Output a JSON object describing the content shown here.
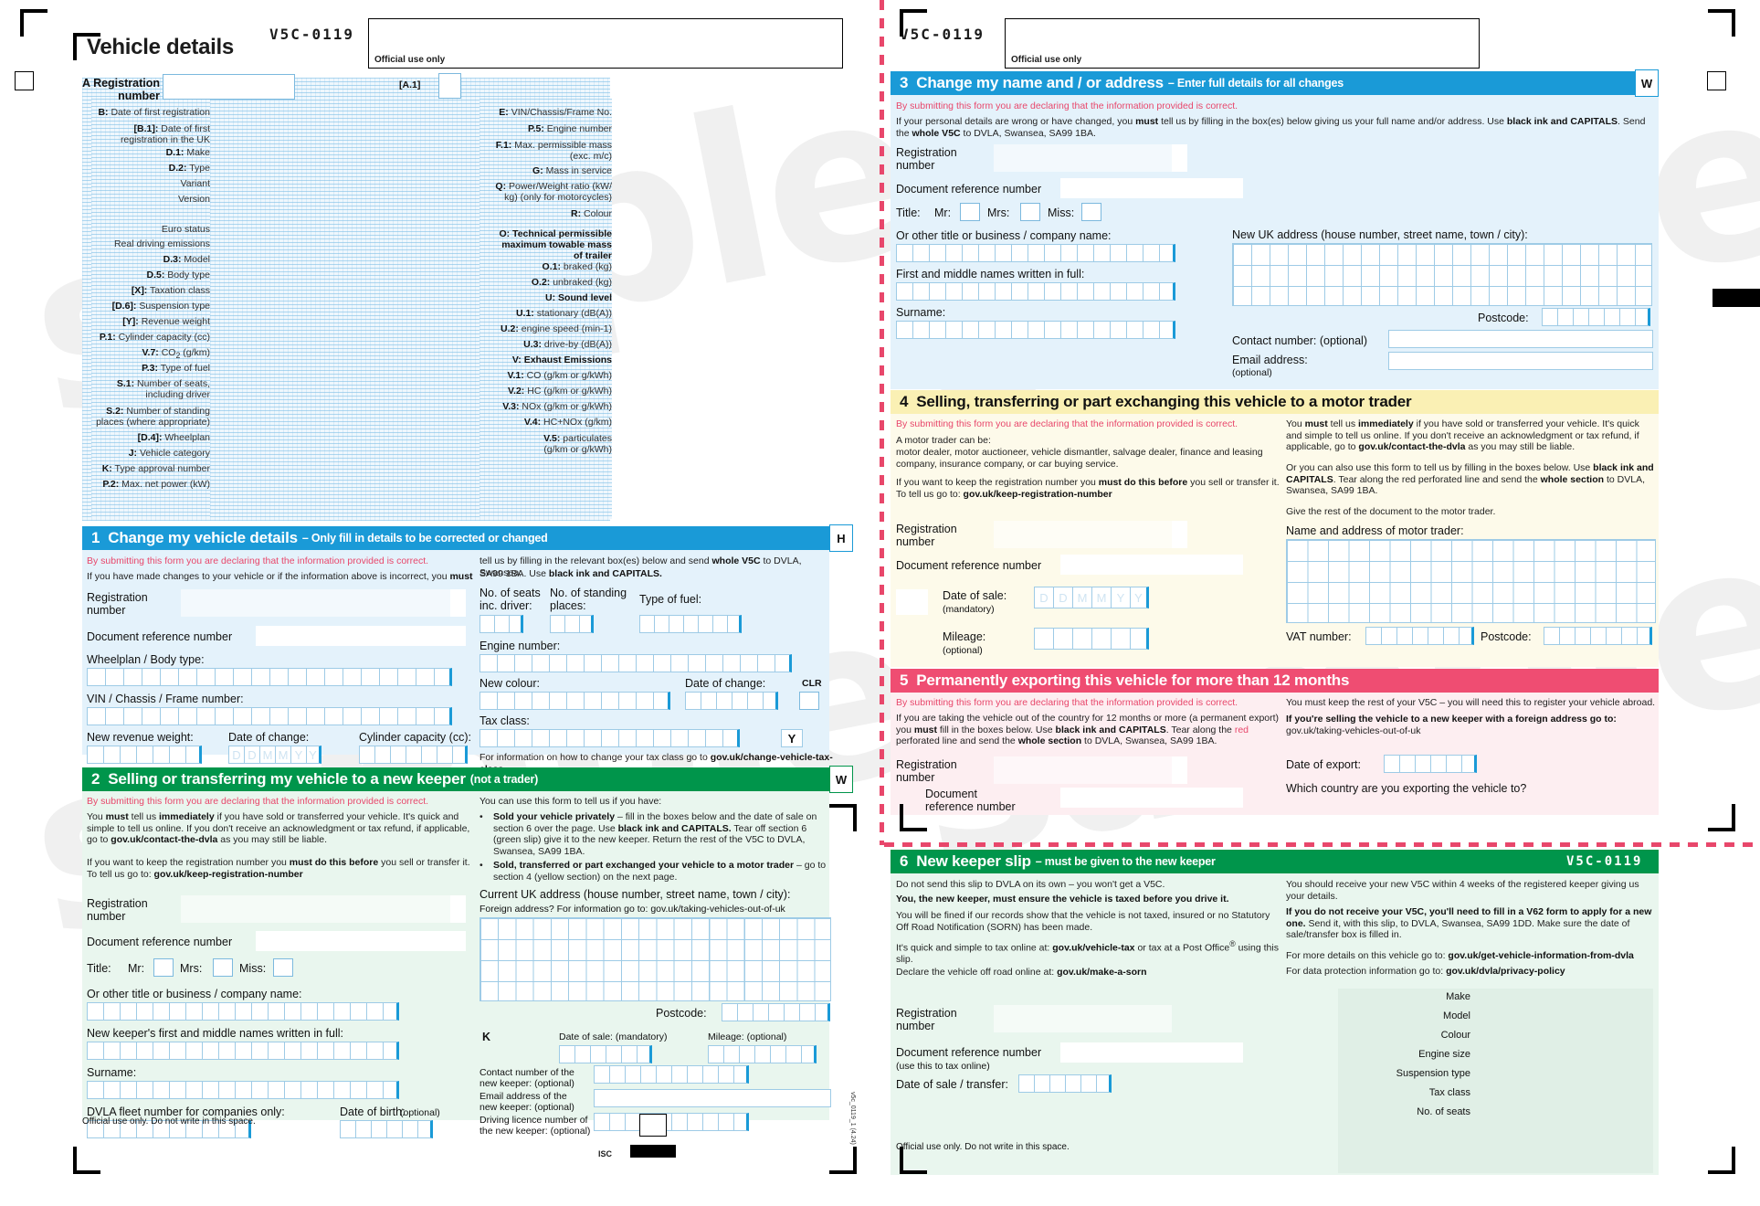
{
  "document": {
    "code": "V5C-0119",
    "title": "Vehicle details",
    "official_use_only": "Official use only",
    "watermark": "sample",
    "isc_label": "ISC",
    "side_text": "v5c_0119_1 (4.24)"
  },
  "colors": {
    "blue": "#1a9ad7",
    "green": "#00954b",
    "yellow": "#faf0b4",
    "pink": "#ef4d72",
    "red_text": "#e8476b",
    "tint_blue": "#e4f2fb",
    "tint_green": "#e9f6ee",
    "tint_yellow": "#fdfaea",
    "tint_pink": "#fdeef1"
  },
  "vehicle_details": {
    "reg_label_line1": "A Registration",
    "reg_label_line2": "number",
    "a1_label": "[A.1]",
    "left_labels": [
      "B: Date of first registration",
      "[B.1]: Date of first<br>registration in the UK",
      "D.1: Make",
      "D.2: Type",
      "Variant",
      "Version",
      "Euro status",
      "Real driving emissions",
      "D.3: Model",
      "D.5: Body type",
      "[X]: Taxation class",
      "[D.6]: Suspension type",
      "[Y]: Revenue weight",
      "P.1: Cylinder capacity (cc)",
      "V.7: CO2 (g/km)",
      "P.3: Type of fuel",
      "S.1: Number of seats,<br>including driver",
      "S.2: Number of standing<br>places (where appropriate)",
      "[D.4]: Wheelplan",
      "J: Vehicle category",
      "K: Type approval number",
      "P.2: Max. net power (kW)"
    ],
    "right_labels": [
      "E: VIN/Chassis/Frame No.",
      "P.5: Engine number",
      "F.1: Max. permissible mass<br>(exc. m/c)",
      "G: Mass in service",
      "Q: Power/Weight ratio (kW/<br>kg) (only for motorcycles)",
      "R: Colour",
      "O: Technical permissible<br>maximum towable mass<br>of trailer",
      "O.1: braked (kg)",
      "O.2: unbraked (kg)",
      "U: Sound level",
      "U.1: stationary (dB(A))",
      "U.2: engine speed (min-1)",
      "U.3: drive-by (dB(A))",
      "V: Exhaust Emissions",
      "V.1: CO (g/km or g/kWh)",
      "V.2: HC (g/km or g/kWh)",
      "V.3: NOx (g/km or g/kWh)",
      "V.4: HC+NOx (g/km)",
      "V.5: particulates<br>(g/km or g/kWh)"
    ]
  },
  "section1": {
    "number": "1",
    "title": "Change my vehicle details",
    "subtitle": "– Only fill in details to be corrected or changed",
    "tab": "H",
    "declaration": "By submitting this form you are declaring that the information provided is correct.",
    "intro_left": "If you have made changes to your vehicle or if the information above is incorrect, you <b>must</b>",
    "intro_right_1": "tell us by filling in the relevant box(es) below and send <b>whole V5C</b> to DVLA, Swansea,",
    "intro_right_2": "SA99 1BA. Use <b>black ink and CAPITALS.</b>",
    "reg_label_1": "Registration",
    "reg_label_2": "number",
    "doc_ref_label": "Document reference number",
    "wheelplan_label": "Wheelplan / Body type:",
    "vin_label": "VIN / Chassis / Frame number:",
    "new_revenue_label": "New revenue weight:",
    "date_change_label": "Date of change:",
    "cylinder_label": "Cylinder capacity (cc):",
    "seats_label_1": "No. of seats",
    "seats_label_2": "inc. driver:",
    "standing_label_1": "No. of standing",
    "standing_label_2": "places:",
    "fuel_label": "Type of fuel:",
    "engine_label": "Engine number:",
    "new_colour_label": "New colour:",
    "date_change_label2": "Date of change:",
    "clr_tab": "CLR",
    "tax_class_label": "Tax class:",
    "y_tab": "Y",
    "tax_footer": "For information on how to change your tax class go to <b>gov.uk/change-vehicle-tax-class</b>",
    "date_ghost": [
      "D",
      "D",
      "M",
      "M",
      "Y",
      "Y"
    ]
  },
  "section2": {
    "number": "2",
    "title": "Selling or transferring my vehicle to a new keeper",
    "subtitle": "(not a trader)",
    "tab": "W",
    "declaration": "By submitting this form you are declaring that the information provided is correct.",
    "para1": "You <b>must</b> tell us <b>immediately</b> if you have sold or transferred your vehicle. It's quick and simple to tell us online. If you don't receive an acknowledgment or tax refund, if applicable, go to <b>gov.uk/contact-the-dvla</b> as you may still be liable.",
    "para2": "If you want to keep the registration number you <b>must do this before</b> you sell or transfer it. To tell us go to: <b>gov.uk/keep-registration-number</b>",
    "right_intro": "You can use this form to tell us if you have:",
    "bullet1": "<b>Sold your vehicle privately</b> – fill in the boxes below and the date of sale on section 6 over the page. Use <b>black ink and CAPITALS.</b> Tear off section 6 (green slip) give it to the new keeper. Return the rest of the V5C to DVLA, Swansea, SA99 1BA.",
    "bullet2": "<b>Sold, transferred or part exchanged your vehicle to a motor trader</b> – go to section 4 (yellow section) on the next page.",
    "reg_label_1": "Registration",
    "reg_label_2": "number",
    "doc_ref_label": "Document reference number",
    "title_label": "Title:",
    "title_mr": "Mr:",
    "title_mrs": "Mrs:",
    "title_miss": "Miss:",
    "other_title_label": "Or other title or business / company name:",
    "first_names_label": "New keeper's first and middle names written in full:",
    "surname_label": "Surname:",
    "fleet_label": "DVLA fleet number for companies only:",
    "dob_label": "Date of birth:",
    "dob_optional": "(optional)",
    "address_label": "Current UK address (house number, street name, town / city):",
    "foreign_label": "Foreign address? For information go to: gov.uk/taking-vehicles-out-of-uk",
    "postcode_label": "Postcode:",
    "date_sale_label": "Date of sale: (mandatory)",
    "mileage_label": "Mileage: (optional)",
    "k_tab": "K",
    "contact_label_1": "Contact number of the",
    "contact_label_2": "new keeper: (optional)",
    "email_label_1": "Email address of the",
    "email_label_2": "new keeper: (optional)",
    "licence_label_1": "Driving licence number of",
    "licence_label_2": "the new keeper: (optional)",
    "footer": "Official use only. Do not write in this space."
  },
  "section3": {
    "number": "3",
    "title": "Change my name and / or address",
    "subtitle": "– Enter full details for all changes",
    "tab": "W",
    "declaration": "By submitting this form you are declaring that the information provided is correct.",
    "para1": "If your personal details are wrong or have changed, you <b>must</b> tell us by filling in the box(es) below giving us your full name and/or address. Use <b>black ink and CAPITALS</b>. Send the <b>whole V5C</b> to DVLA, Swansea, SA99 1BA.",
    "reg_label_1": "Registration",
    "reg_label_2": "number",
    "doc_ref_label": "Document reference number",
    "title_label": "Title:",
    "title_mr": "Mr:",
    "title_mrs": "Mrs:",
    "title_miss": "Miss:",
    "other_title_label": "Or other title or business / company name:",
    "first_names_label": "First and middle names written in full:",
    "surname_label": "Surname:",
    "address_label": "New UK address (house number, street name, town / city):",
    "postcode_label": "Postcode:",
    "contact_label": "Contact number: (optional)",
    "email_label_1": "Email address:",
    "email_label_2": "(optional)"
  },
  "section4": {
    "number": "4",
    "title": "Selling, transferring or part exchanging this vehicle to a motor trader",
    "declaration": "By submitting this form you are declaring that the information provided is correct.",
    "trader_intro": "A motor trader can be:",
    "trader_list": "motor dealer, motor auctioneer, vehicle dismantler, salvage dealer, finance and leasing company, insurance company, or car buying service.",
    "keep_reg": "If you want to keep the registration number you <b>must do this before</b> you sell or transfer it. To tell us go to: <b>gov.uk/keep-registration-number</b>",
    "right_para1": "You <b>must</b> tell us <b>immediately</b> if you have sold or transferred your vehicle. It's quick and simple to tell us online. If you don't receive an acknowledgment or tax refund, if applicable, go to <b>gov.uk/contact-the-dvla</b> as you may still be liable.",
    "right_para2": "Or you can also use this form to tell us by filling in the boxes below. Use <b>black ink and CAPITALS</b>. Tear along the red perforated line and send the <b>whole section</b> to DVLA, Swansea, SA99 1BA.",
    "right_para3": "Give the rest of the document to the motor trader.",
    "reg_label_1": "Registration",
    "reg_label_2": "number",
    "doc_ref_label": "Document reference number",
    "date_sale_label_1": "Date of sale:",
    "date_sale_label_2": "(mandatory)",
    "mileage_label_1": "Mileage:",
    "mileage_label_2": "(optional)",
    "trader_name_label": "Name and address of motor trader:",
    "vat_label": "VAT number:",
    "postcode_label": "Postcode:",
    "date_ghost": [
      "D",
      "D",
      "M",
      "M",
      "Y",
      "Y"
    ]
  },
  "section5": {
    "number": "5",
    "title": "Permanently exporting this vehicle for more than 12 months",
    "declaration": "By submitting this form you are declaring that the information provided is correct.",
    "para1": "If you are taking the vehicle out of the country for 12 months or more (a permanent export) you <b>must</b> fill in the boxes below. Use <b>black ink and CAPITALS</b>. Tear along the <span style=\"color:#e8476b\">red</span> perforated line and send the <b>whole section</b> to DVLA, Swansea, SA99 1BA.",
    "right_para1": "You must keep the rest of your V5C – you will need this to register your vehicle abroad.",
    "right_para2": "<b>If you're selling the vehicle to a new keeper with a foreign address go to:</b> gov.uk/taking-vehicles-out-of-uk",
    "reg_label_1": "Registration",
    "reg_label_2": "number",
    "doc_ref_label_1": "Document",
    "doc_ref_label_2": "reference number",
    "date_export_label": "Date of export:",
    "country_label": "Which country are you exporting the vehicle to?"
  },
  "section6": {
    "number": "6",
    "title": "New keeper slip",
    "subtitle": "– must be given to the new keeper",
    "code": "V5C-0119",
    "para1": "Do not send this slip to DVLA on its own – you won't get a V5C.",
    "para2": "<b>You, the new keeper, must ensure the vehicle is taxed before you drive it.</b>",
    "para3": "You will be fined if our records show that the vehicle is not taxed, insured or no Statutory Off Road Notification (SORN) has been made.",
    "para4": "It's quick and simple to tax online at: <b>gov.uk/vehicle-tax</b> or tax at a Post Office<sup>®</sup> using this slip.",
    "para5": "Declare the vehicle off road online at: <b>gov.uk/make-a-sorn</b>",
    "right_para1": "You should receive your new V5C within 4 weeks of the registered keeper giving us your details.",
    "right_para2": "<b>If you do not receive your V5C, you'll need to fill in a V62 form to apply for a new one.</b> Send it, with this slip, to DVLA, Swansea, SA99 1DD. Make sure the date of sale/transfer box is filled in.",
    "right_para3": "For more details on this vehicle go to: <b>gov.uk/get-vehicle-information-from-dvla</b>",
    "right_para4": "For data protection information go to: <b>gov.uk/dvla/privacy-policy</b>",
    "reg_label_1": "Registration",
    "reg_label_2": "number",
    "doc_ref_label_1": "Document reference number",
    "doc_ref_label_2": "(use this to tax online)",
    "date_sale_label": "Date of sale / transfer:",
    "vehicle_labels": [
      "Make",
      "Model",
      "Colour",
      "Engine size",
      "Suspension type",
      "Tax class",
      "No. of seats"
    ],
    "footer": "Official use only. Do not write in this space."
  }
}
